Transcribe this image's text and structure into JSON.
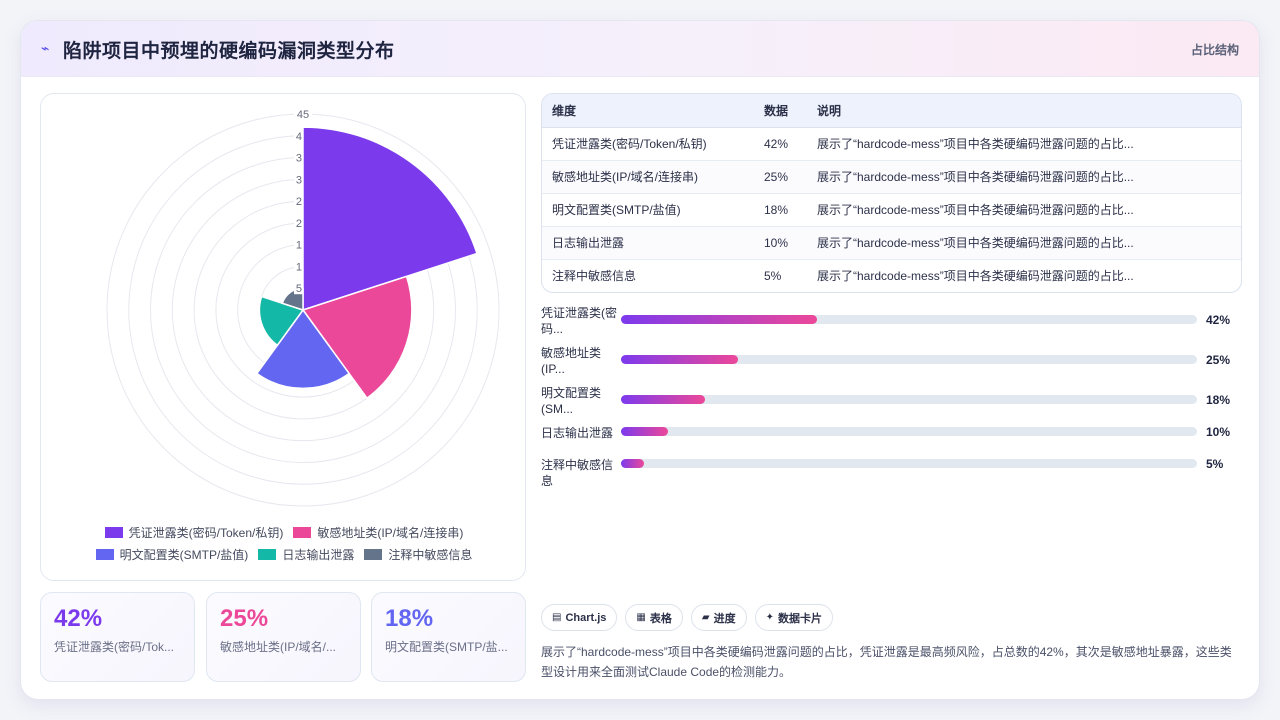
{
  "header": {
    "icon": "sparkle-icon",
    "title": "陷阱项目中预埋的硬编码漏洞类型分布",
    "right_label": "占比结构"
  },
  "chart_data": {
    "type": "polarArea",
    "categories": [
      "凭证泄露类(密码/Token/私钥)",
      "敏感地址类(IP/域名/连接串)",
      "明文配置类(SMTP/盐值)",
      "日志输出泄露",
      "注释中敏感信息"
    ],
    "values": [
      42,
      25,
      18,
      10,
      5
    ],
    "colors": [
      "#7c3aed",
      "#ec4899",
      "#6366f1",
      "#14b8a6",
      "#64748b"
    ],
    "r_ticks": [
      "45",
      "4",
      "3",
      "3",
      "2",
      "2",
      "1",
      "1",
      "5"
    ],
    "rmax": 45,
    "grid": true,
    "legend": "bottom"
  },
  "legend": {
    "items": [
      "凭证泄露类(密码/Token/私钥)",
      "敏感地址类(IP/域名/连接串)",
      "明文配置类(SMTP/盐值)",
      "日志输出泄露",
      "注释中敏感信息"
    ]
  },
  "stats": [
    {
      "value": "42%",
      "label": "凭证泄露类(密码/Tok...",
      "color": "#7c3aed"
    },
    {
      "value": "25%",
      "label": "敏感地址类(IP/域名/...",
      "color": "#ec4899"
    },
    {
      "value": "18%",
      "label": "明文配置类(SMTP/盐...",
      "color": "#6366f1"
    }
  ],
  "table": {
    "headers": [
      "维度",
      "数据",
      "说明"
    ],
    "rows": [
      [
        "凭证泄露类(密码/Token/私钥)",
        "42%",
        "展示了“hardcode-mess”项目中各类硬编码泄露问题的占比..."
      ],
      [
        "敏感地址类(IP/域名/连接串)",
        "25%",
        "展示了“hardcode-mess”项目中各类硬编码泄露问题的占比..."
      ],
      [
        "明文配置类(SMTP/盐值)",
        "18%",
        "展示了“hardcode-mess”项目中各类硬编码泄露问题的占比..."
      ],
      [
        "日志输出泄露",
        "10%",
        "展示了“hardcode-mess”项目中各类硬编码泄露问题的占比..."
      ],
      [
        "注释中敏感信息",
        "5%",
        "展示了“hardcode-mess”项目中各类硬编码泄露问题的占比..."
      ]
    ]
  },
  "progress": [
    {
      "label": "凭证泄露类(密码...",
      "value": 42,
      "pct": "42%"
    },
    {
      "label": "敏感地址类(IP...",
      "value": 25,
      "pct": "25%"
    },
    {
      "label": "明文配置类(SM...",
      "value": 18,
      "pct": "18%"
    },
    {
      "label": "日志输出泄露",
      "value": 10,
      "pct": "10%"
    },
    {
      "label": "注释中敏感信息",
      "value": 5,
      "pct": "5%"
    }
  ],
  "chips": [
    {
      "icon": "chart-icon",
      "glyph": "▤",
      "label": "Chart.js"
    },
    {
      "icon": "table-icon",
      "glyph": "▦",
      "label": "表格"
    },
    {
      "icon": "progress-icon",
      "glyph": "▰",
      "label": "进度"
    },
    {
      "icon": "card-icon",
      "glyph": "✦",
      "label": "数据卡片"
    }
  ],
  "description": "展示了“hardcode-mess”项目中各类硬编码泄露问题的占比，凭证泄露是最高频风险，占总数的42%，其次是敏感地址暴露，这些类型设计用来全面测试Claude Code的检测能力。"
}
